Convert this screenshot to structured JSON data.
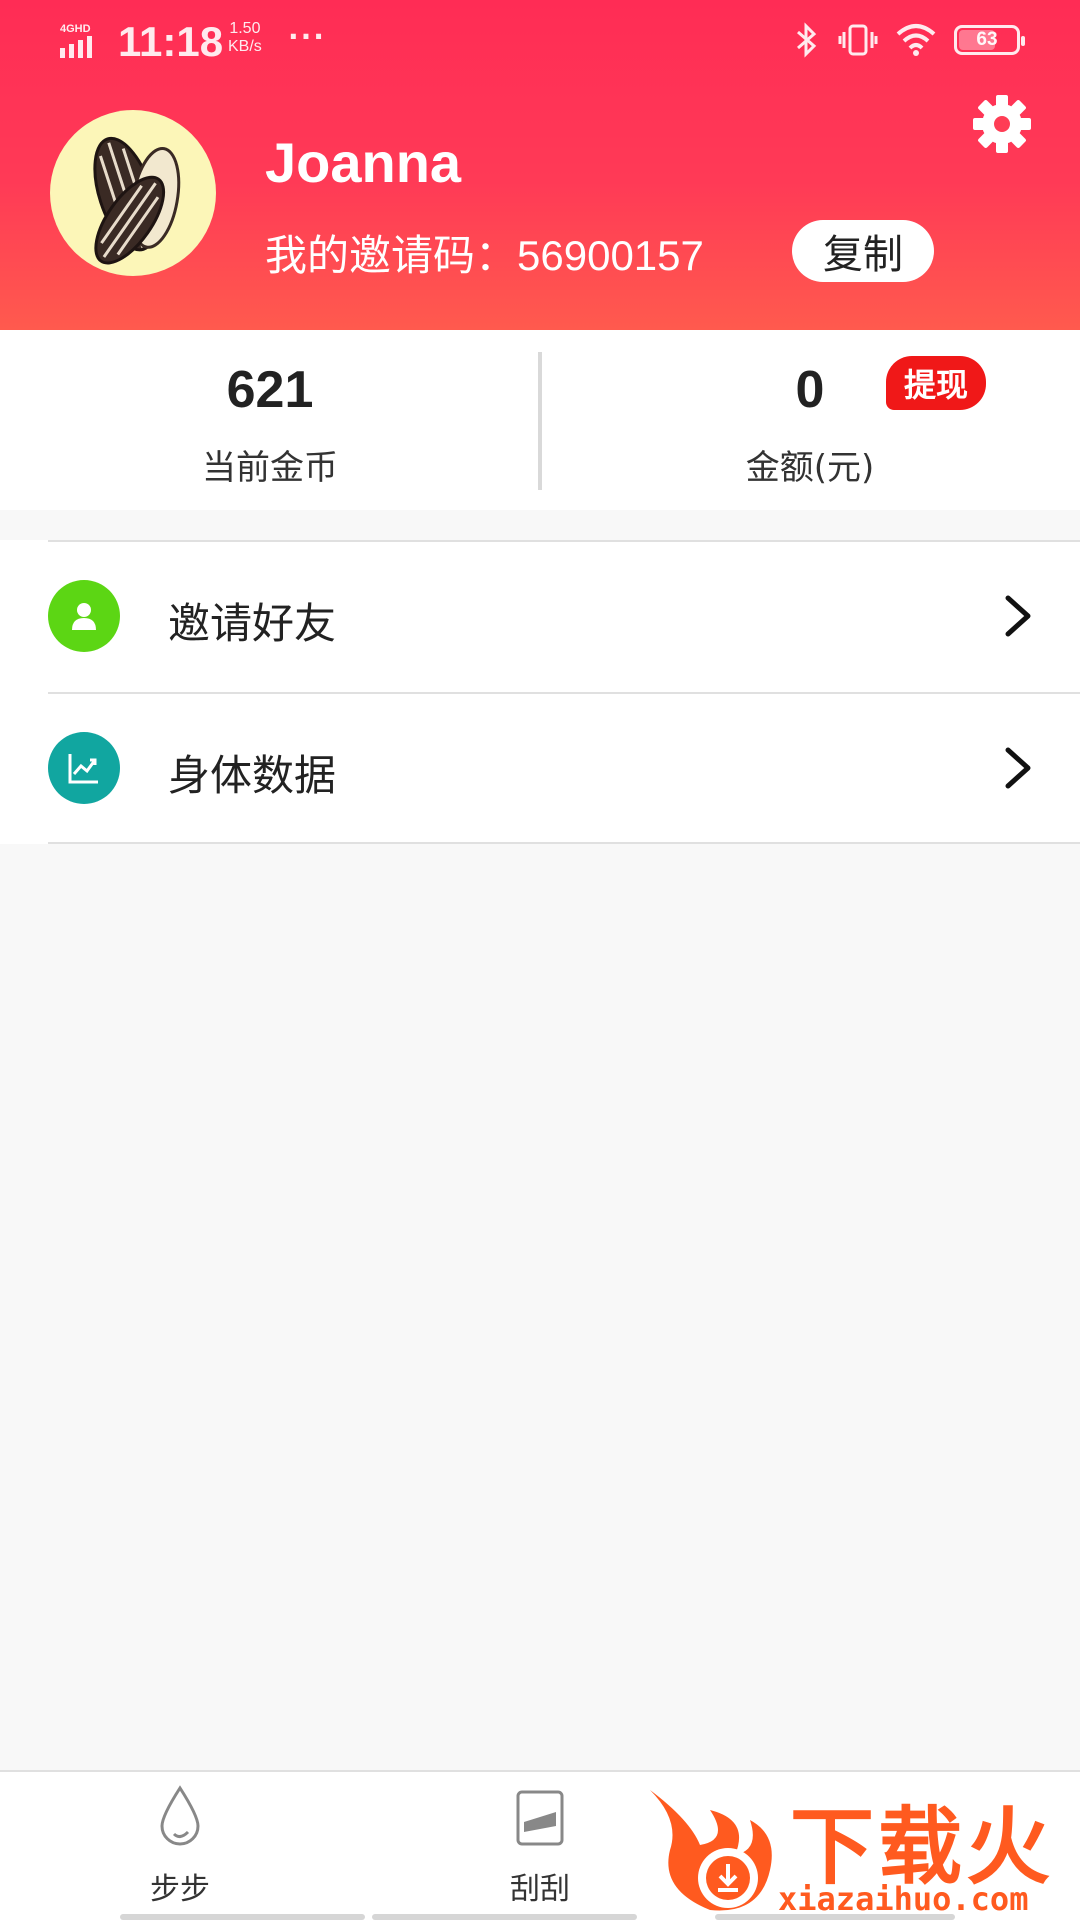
{
  "status_bar": {
    "network": "4GHD",
    "time": "11:18",
    "speed_value": "1.50",
    "speed_unit": "KB/s",
    "dots": "···",
    "battery": "63"
  },
  "profile": {
    "username": "Joanna",
    "invite_label": "我的邀请码：",
    "invite_code": "56900157",
    "copy_label": "复制",
    "avatar_icon": "sunflower-seeds-avatar",
    "settings_icon": "gear-icon"
  },
  "stats": {
    "coins_value": "621",
    "coins_label": "当前金币",
    "amount_value": "0",
    "amount_label": "金额(元)",
    "withdraw_label": "提现"
  },
  "menu": {
    "items": [
      {
        "label": "邀请好友",
        "icon": "person-icon",
        "color": "#5cd614"
      },
      {
        "label": "身体数据",
        "icon": "chart-icon",
        "color": "#11a6a0"
      }
    ]
  },
  "bottom_nav": {
    "items": [
      {
        "label": "步步",
        "icon": "drop-icon"
      },
      {
        "label": "刮刮",
        "icon": "scratch-card-icon"
      }
    ]
  },
  "watermark": {
    "text": "下载火",
    "url": "xiazaihuo.com"
  },
  "colors": {
    "header_top": "#ff2c55",
    "header_bottom": "#ff5a4e",
    "withdraw_badge": "#f01818"
  }
}
